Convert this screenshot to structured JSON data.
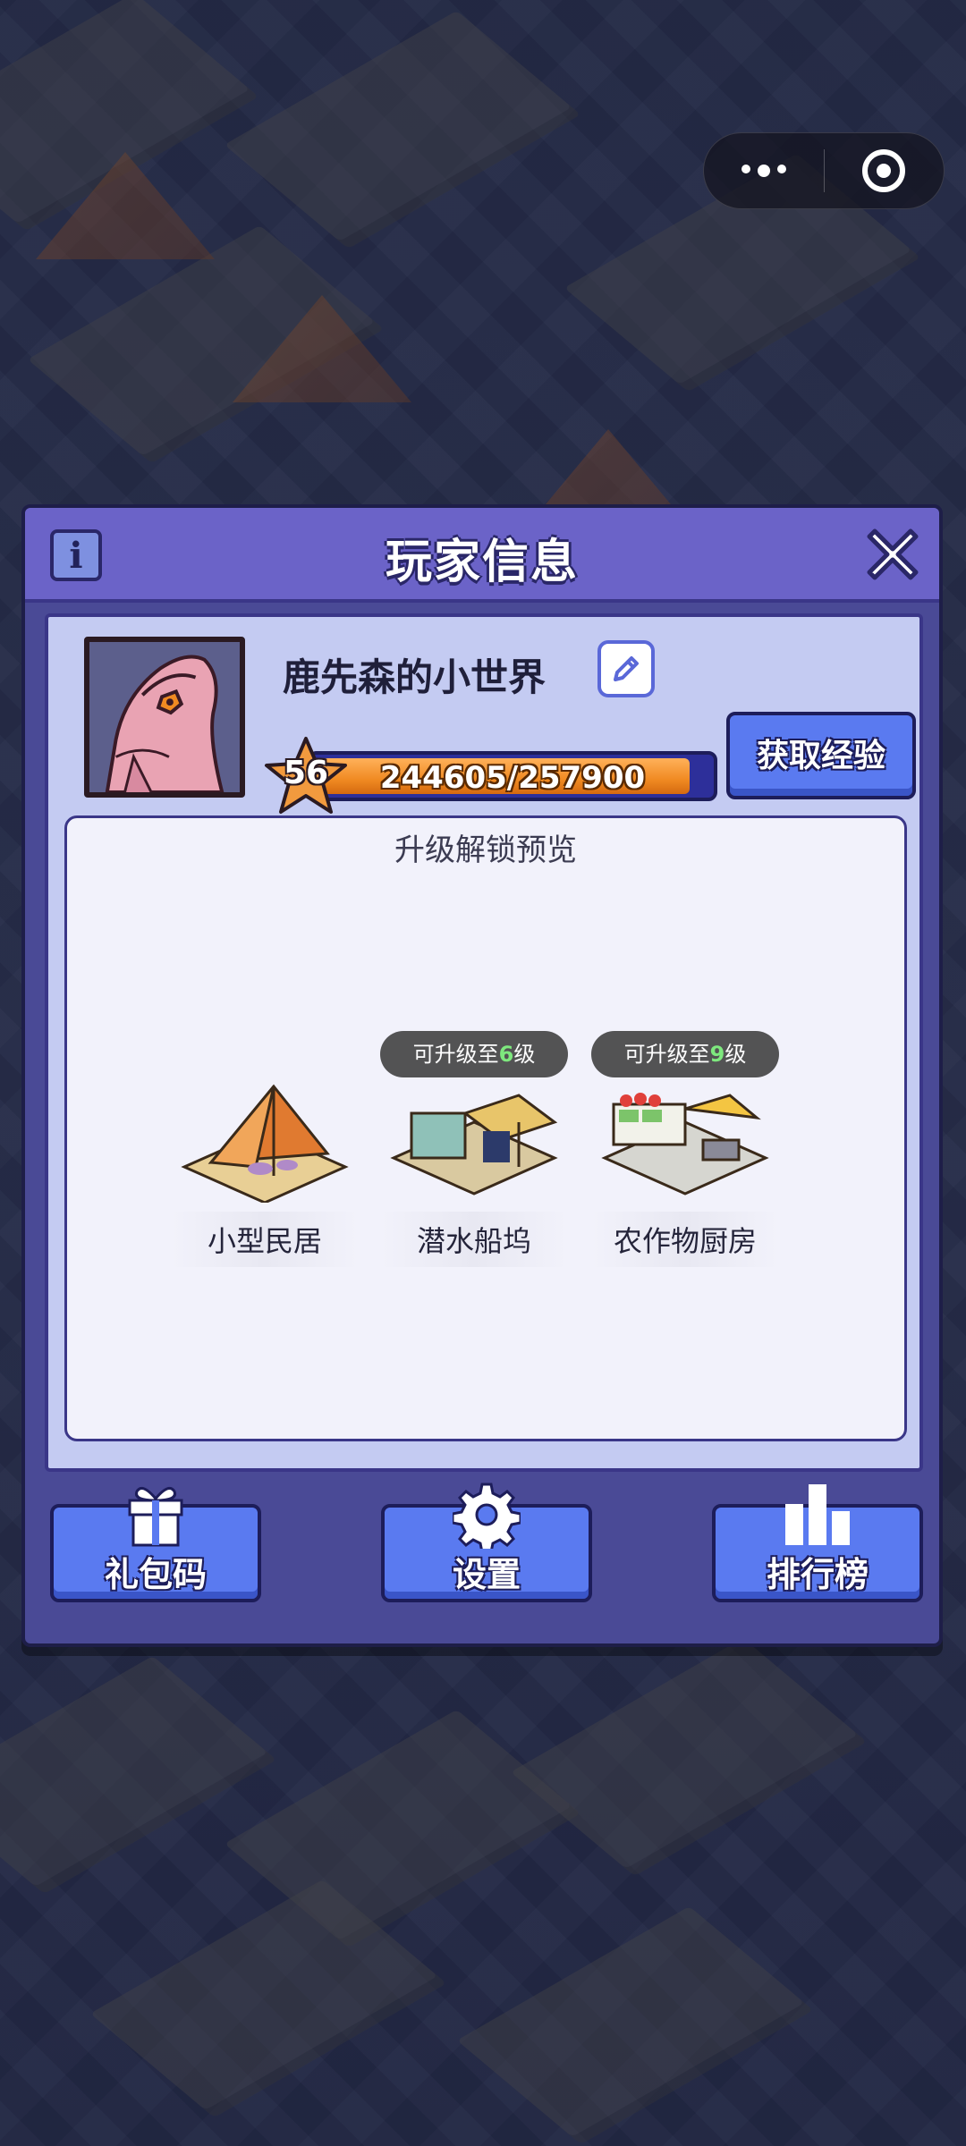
{
  "dialog": {
    "title": "玩家信息",
    "info_icon": "info-icon",
    "close_icon": "close-icon"
  },
  "player": {
    "name": "鹿先森的小世界",
    "level": "56",
    "xp_text": "244605/257900",
    "xp_current": 244605,
    "xp_max": 257900,
    "get_xp_label": "获取经验"
  },
  "preview": {
    "title": "升级解锁预览",
    "buildings": [
      {
        "name": "小型民居",
        "tag_prefix": "",
        "tag_level": "",
        "tag_suffix": ""
      },
      {
        "name": "潜水船坞",
        "tag_prefix": "可升级至",
        "tag_level": "6",
        "tag_suffix": "级"
      },
      {
        "name": "农作物厨房",
        "tag_prefix": "可升级至",
        "tag_level": "9",
        "tag_suffix": "级"
      }
    ]
  },
  "bottom_buttons": [
    {
      "label": "礼包码",
      "icon": "gift-icon"
    },
    {
      "label": "设置",
      "icon": "gear-icon"
    },
    {
      "label": "排行榜",
      "icon": "leaderboard-icon"
    }
  ],
  "colors": {
    "dialog_bg": "#4a4a96",
    "header_bg": "#6b63c8",
    "panel_bg": "#c4cbf2",
    "button_bg": "#5a7af0",
    "xp_fill": "#f08a22",
    "tag_level_color": "#7ee87e"
  }
}
